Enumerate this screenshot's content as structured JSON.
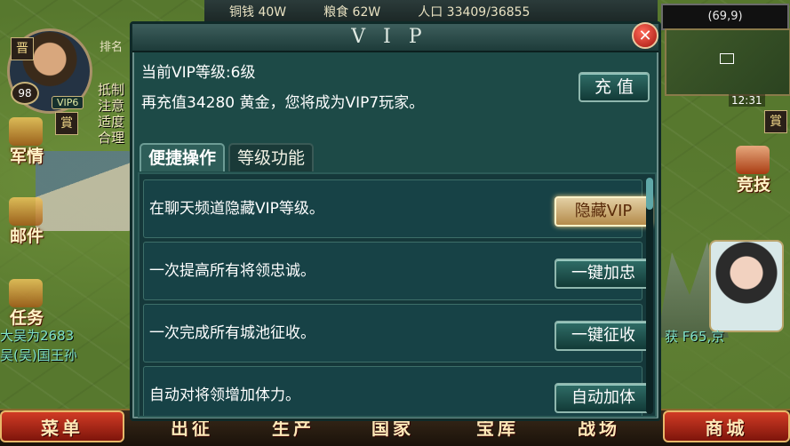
{
  "topbar": {
    "copper": "铜钱 40W",
    "food": "粮食 62W",
    "population": "人口 33409/36855"
  },
  "player": {
    "state": "晋",
    "level": "98",
    "vip_badge": "VIP6",
    "rank_label": "排名"
  },
  "left_menu": {
    "military": "军情",
    "mail": "邮件",
    "tasks": "任务",
    "info_lines": [
      "抵制",
      "注意",
      "适度",
      "合理"
    ],
    "shop_badge": "賞"
  },
  "chat": {
    "line1": "大吴为2683",
    "line2": "吴(吴)国王孙"
  },
  "right_panel": {
    "coords": "(69,9)",
    "clock": "12:31",
    "arena": "竞技",
    "right_badge": "賞",
    "right_text": "获 F65,京"
  },
  "bottom_nav": {
    "menu": "菜单",
    "expedition": "出征",
    "produce": "生产",
    "nation": "国家",
    "treasury": "宝库",
    "battle": "战场",
    "shop": "商城"
  },
  "vip_dialog": {
    "title": "VIP",
    "close_label": "✕",
    "current_level": "当前VIP等级:6级",
    "recharge_hint": "再充值34280 黄金，您将成为VIP7玩家。",
    "recharge_button": "充 值",
    "tabs": [
      {
        "label": "便捷操作",
        "active": true
      },
      {
        "label": "等级功能",
        "active": false
      }
    ],
    "rows": [
      {
        "description": "在聊天频道隐藏VIP等级。",
        "button": "隐藏VIP"
      },
      {
        "description": "一次提高所有将领忠诚。",
        "button": "一键加忠"
      },
      {
        "description": "一次完成所有城池征收。",
        "button": "一键征收"
      },
      {
        "description": "自动对将领增加体力。",
        "button": "自动加体"
      }
    ]
  },
  "colors": {
    "dialog_bg": "#1d4a47",
    "button_bg": "#2f6d67",
    "highlight_button": "#e3cfa3",
    "red_button": "#d13b25"
  }
}
